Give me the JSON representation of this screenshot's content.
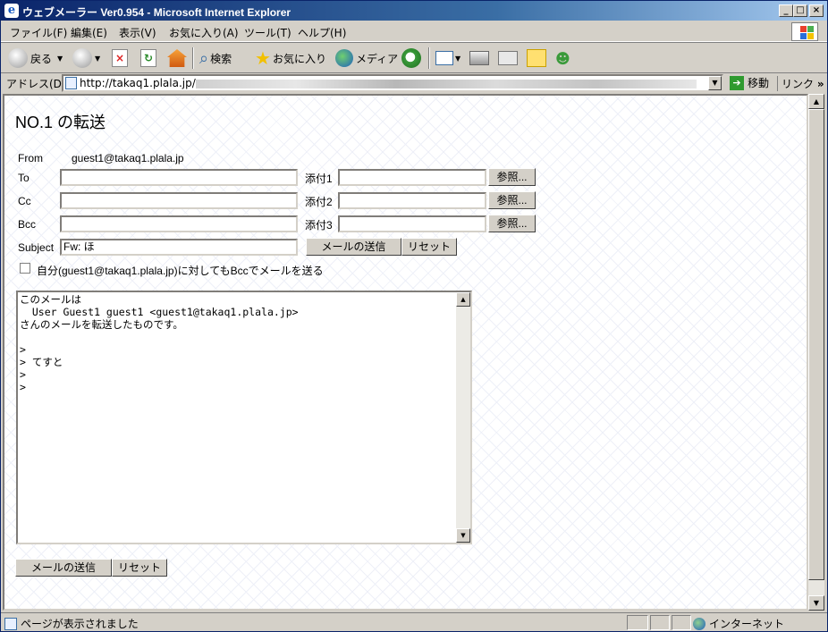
{
  "window": {
    "title": "ウェブメーラー Ver0.954 - Microsoft Internet Explorer",
    "min": "_",
    "max": "□",
    "close": "×"
  },
  "menu": [
    "ファイル(F)",
    "編集(E)",
    "表示(V)",
    "お気に入り(A)",
    "ツール(T)",
    "ヘルプ(H)"
  ],
  "toolbar": {
    "back": "戻る",
    "search": "検索",
    "favorites": "お気に入り",
    "media": "メディア"
  },
  "address": {
    "label": "アドレス(D)",
    "url": "http://takaq1.plala.jp/",
    "go": "移動",
    "links": "リンク"
  },
  "page": {
    "title": "NO.1 の転送",
    "from_label": "From",
    "from_value": "guest1@takaq1.plala.jp",
    "to_label": "To",
    "cc_label": "Cc",
    "bcc_label": "Bcc",
    "subject_label": "Subject",
    "subject_value": "Fw: ほ",
    "attach1_label": "添付1",
    "attach2_label": "添付2",
    "attach3_label": "添付3",
    "browse": "参照...",
    "send": "メールの送信",
    "reset": "リセット",
    "bcc_self": "自分(guest1@takaq1.plala.jp)に対してもBccでメールを送る",
    "body": "このメールは\n  User Guest1 guest1 <guest1@takaq1.plala.jp>\nさんのメールを転送したものです。\n\n>\n> てすと\n>\n>"
  },
  "status": {
    "text": "ページが表示されました",
    "zone": "インターネット"
  }
}
